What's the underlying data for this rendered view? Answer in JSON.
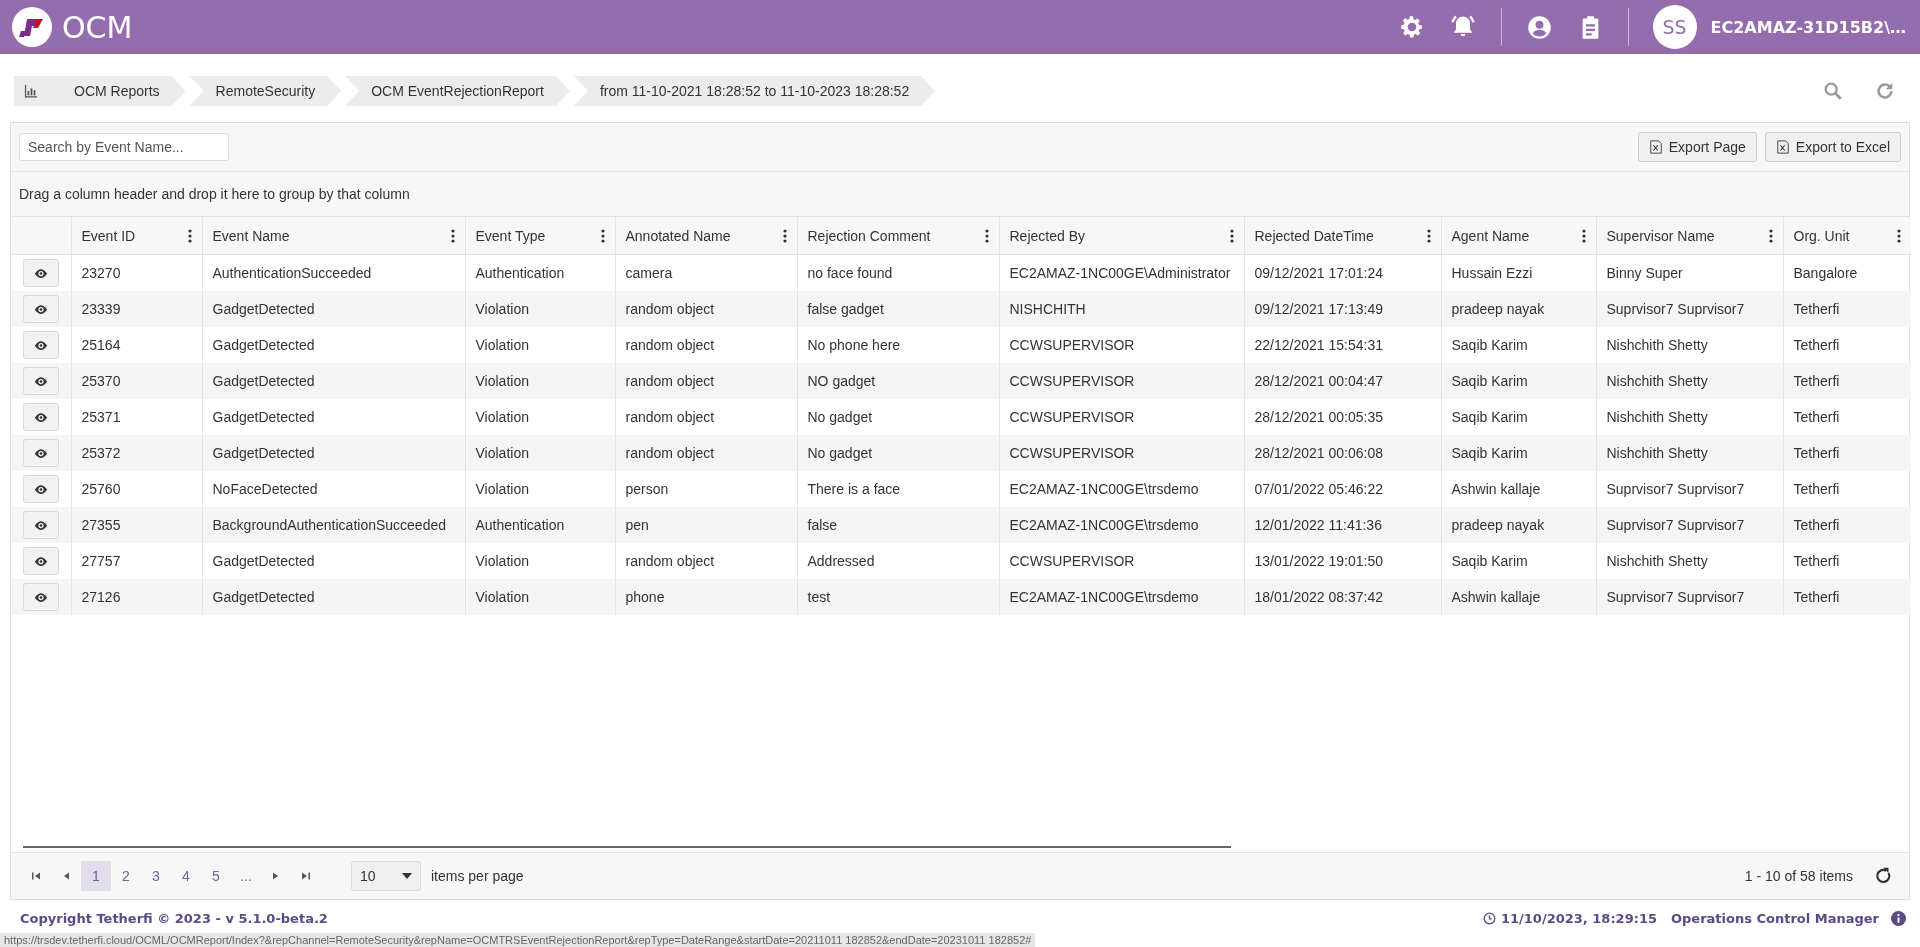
{
  "header": {
    "logo_text": "OCM",
    "avatar_initials": "SS",
    "user_name": "EC2AMAZ-31D15B2\\…"
  },
  "breadcrumbs": [
    "OCM Reports",
    "RemoteSecurity",
    "OCM EventRejectionReport",
    "from 11-10-2021 18:28:52 to 11-10-2023 18:28:52"
  ],
  "toolbar": {
    "search": {
      "placeholder": "Search by Event Name..."
    },
    "buttons": [
      "Export Page",
      "Export to Excel"
    ]
  },
  "group_panel": "Drag a column header and drop it here to group by that column",
  "table": {
    "columns": [
      "Event ID",
      "Event Name",
      "Event Type",
      "Annotated Name",
      "Rejection Comment",
      "Rejected By",
      "Rejected DateTime",
      "Agent Name",
      "Supervisor Name",
      "Org. Unit"
    ],
    "rows": [
      [
        "23270",
        "AuthenticationSucceeded",
        "Authentication",
        "camera",
        "no face found",
        "EC2AMAZ-1NC00GE\\Administrator",
        "09/12/2021 17:01:24",
        "Hussain Ezzi",
        "Binny Super",
        "Bangalore"
      ],
      [
        "23339",
        "GadgetDetected",
        "Violation",
        "random object",
        "false gadget",
        "NISHCHITH",
        "09/12/2021 17:13:49",
        "pradeep nayak",
        "Suprvisor7 Suprvisor7",
        "Tetherfi"
      ],
      [
        "25164",
        "GadgetDetected",
        "Violation",
        "random object",
        "No phone here",
        "CCWSUPERVISOR",
        "22/12/2021 15:54:31",
        "Saqib Karim",
        "Nishchith Shetty",
        "Tetherfi"
      ],
      [
        "25370",
        "GadgetDetected",
        "Violation",
        "random object",
        "NO gadget",
        "CCWSUPERVISOR",
        "28/12/2021 00:04:47",
        "Saqib Karim",
        "Nishchith Shetty",
        "Tetherfi"
      ],
      [
        "25371",
        "GadgetDetected",
        "Violation",
        "random object",
        "No gadget",
        "CCWSUPERVISOR",
        "28/12/2021 00:05:35",
        "Saqib Karim",
        "Nishchith Shetty",
        "Tetherfi"
      ],
      [
        "25372",
        "GadgetDetected",
        "Violation",
        "random object",
        "No gadget",
        "CCWSUPERVISOR",
        "28/12/2021 00:06:08",
        "Saqib Karim",
        "Nishchith Shetty",
        "Tetherfi"
      ],
      [
        "25760",
        "NoFaceDetected",
        "Violation",
        "person",
        "There is a face",
        "EC2AMAZ-1NC00GE\\trsdemo",
        "07/01/2022 05:46:22",
        "Ashwin kallaje",
        "Suprvisor7 Suprvisor7",
        "Tetherfi"
      ],
      [
        "27355",
        "BackgroundAuthenticationSucceeded",
        "Authentication",
        "pen",
        "false",
        "EC2AMAZ-1NC00GE\\trsdemo",
        "12/01/2022 11:41:36",
        "pradeep nayak",
        "Suprvisor7 Suprvisor7",
        "Tetherfi"
      ],
      [
        "27757",
        "GadgetDetected",
        "Violation",
        "random object",
        "Addressed",
        "CCWSUPERVISOR",
        "13/01/2022 19:01:50",
        "Saqib Karim",
        "Nishchith Shetty",
        "Tetherfi"
      ],
      [
        "27126",
        "GadgetDetected",
        "Violation",
        "phone",
        "test",
        "EC2AMAZ-1NC00GE\\trsdemo",
        "18/01/2022 08:37:42",
        "Ashwin kallaje",
        "Suprvisor7 Suprvisor7",
        "Tetherfi"
      ]
    ]
  },
  "pager": {
    "pages": [
      {
        "label": "1",
        "selected": true
      },
      {
        "label": "2",
        "selected": false
      },
      {
        "label": "3",
        "selected": false
      },
      {
        "label": "4",
        "selected": false
      },
      {
        "label": "5",
        "selected": false
      },
      {
        "label": "...",
        "selected": false
      }
    ],
    "page_size": "10",
    "page_size_label": "items per page",
    "summary": "1 - 10 of 58 items"
  },
  "footer": {
    "copyright": "Copyright Tetherfi © 2023 - v 5.1.0-beta.2",
    "datetime": "11/10/2023, 18:29:15",
    "app_name": "Operations Control Manager"
  },
  "status_url": "https://trsdev.tetherfi.cloud/OCML/OCMReport/Index?&repChannel=RemoteSecurity&repName=OCMTRSEventRejectionReport&repType=DateRange&startDate=20211011 182852&endDate=20231011 182852#"
}
